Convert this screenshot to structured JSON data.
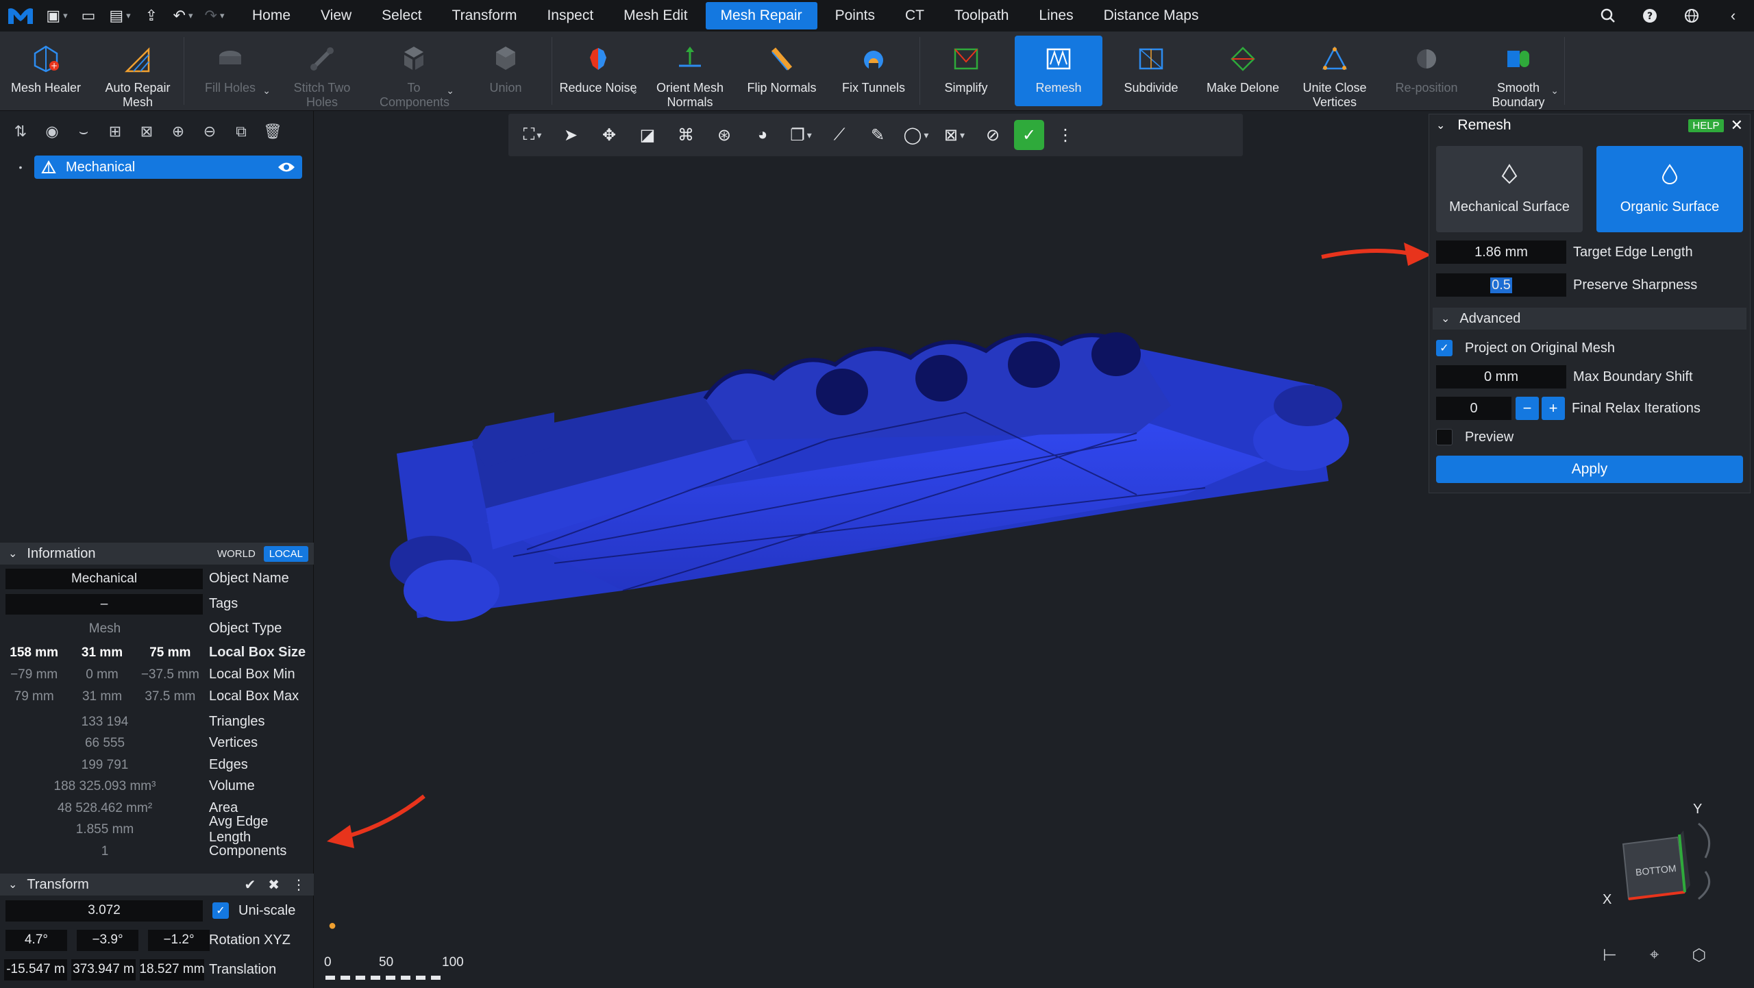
{
  "menubar": {
    "items": [
      "Home",
      "View",
      "Select",
      "Transform",
      "Inspect",
      "Mesh Edit",
      "Mesh Repair",
      "Points",
      "CT",
      "Toolpath",
      "Lines",
      "Distance Maps"
    ],
    "active": "Mesh Repair"
  },
  "ribbon": {
    "buttons": [
      {
        "label": "Mesh Healer",
        "disabled": false
      },
      {
        "label": "Auto Repair Mesh",
        "disabled": false
      },
      {
        "label": "Fill Holes",
        "disabled": true
      },
      {
        "label": "Stitch Two Holes",
        "disabled": true
      },
      {
        "label": "To Components",
        "disabled": true
      },
      {
        "label": "Union",
        "disabled": true
      },
      {
        "label": "Reduce Noise",
        "disabled": false
      },
      {
        "label": "Orient Mesh Normals",
        "disabled": false
      },
      {
        "label": "Flip Normals",
        "disabled": false
      },
      {
        "label": "Fix Tunnels",
        "disabled": false
      },
      {
        "label": "Simplify",
        "disabled": false
      },
      {
        "label": "Remesh",
        "disabled": false
      },
      {
        "label": "Subdivide",
        "disabled": false
      },
      {
        "label": "Make Delone",
        "disabled": false
      },
      {
        "label": "Unite Close Vertices",
        "disabled": false
      },
      {
        "label": "Re-position",
        "disabled": true
      },
      {
        "label": "Smooth Boundary",
        "disabled": false
      }
    ],
    "active": "Remesh"
  },
  "scene": {
    "object": "Mechanical"
  },
  "information": {
    "title": "Information",
    "world": "WORLD",
    "local": "LOCAL",
    "object_name": "Mechanical",
    "object_name_label": "Object Name",
    "tags": "–",
    "tags_label": "Tags",
    "object_type": "Mesh",
    "object_type_label": "Object Type",
    "box_size": [
      "158 mm",
      "31 mm",
      "75 mm"
    ],
    "box_size_label": "Local Box Size",
    "box_min": [
      "−79 mm",
      "0 mm",
      "−37.5 mm"
    ],
    "box_min_label": "Local Box Min",
    "box_max": [
      "79 mm",
      "31 mm",
      "37.5 mm"
    ],
    "box_max_label": "Local Box Max",
    "triangles": "133 194",
    "triangles_label": "Triangles",
    "vertices": "66 555",
    "vertices_label": "Vertices",
    "edges": "199 791",
    "edges_label": "Edges",
    "volume": "188 325.093 mm³",
    "volume_label": "Volume",
    "area": "48 528.462 mm²",
    "area_label": "Area",
    "avg_edge": "1.855 mm",
    "avg_edge_label": "Avg Edge Length",
    "components": "1",
    "components_label": "Components"
  },
  "transform": {
    "title": "Transform",
    "uniscale": "3.072",
    "uniscale_label": "Uni-scale",
    "rotation": [
      "4.7°",
      "−3.9°",
      "−1.2°"
    ],
    "rotation_label": "Rotation XYZ",
    "translation": [
      "-15.547 m",
      "373.947 m",
      "18.527 mm"
    ],
    "translation_label": "Translation"
  },
  "remesh": {
    "title": "Remesh",
    "help": "HELP",
    "mode_mechanical": "Mechanical Surface",
    "mode_organic": "Organic Surface",
    "active_mode": "Organic Surface",
    "target_edge_length": "1.86 mm",
    "target_edge_length_label": "Target Edge Length",
    "preserve_sharpness": "0.5",
    "preserve_sharpness_label": "Preserve Sharpness",
    "advanced_label": "Advanced",
    "project_label": "Project on Original Mesh",
    "project_checked": true,
    "max_boundary_shift": "0 mm",
    "max_boundary_shift_label": "Max Boundary Shift",
    "final_relax": "0",
    "final_relax_label": "Final Relax Iterations",
    "preview_label": "Preview",
    "preview_checked": false,
    "apply_label": "Apply"
  },
  "scale_bar": {
    "ticks": [
      "0",
      "50",
      "100"
    ]
  },
  "view_cube": {
    "face": "BOTTOM",
    "axis_y": "Y",
    "axis_x": "X"
  },
  "colors": {
    "accent": "#1478e0",
    "mesh": "#2a3fe0",
    "green": "#2faa3b",
    "arrow": "#e8341c"
  }
}
